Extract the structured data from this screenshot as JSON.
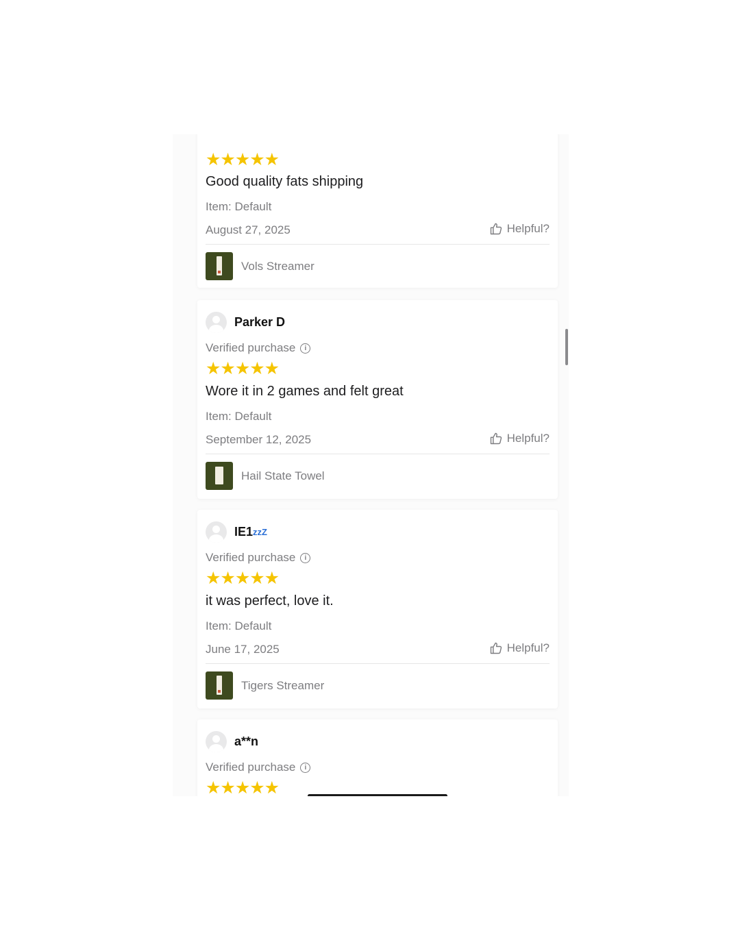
{
  "reviews": [
    {
      "stars": "★★★★★",
      "rating": 5,
      "title": "Good quality fats shipping",
      "item": "Item: Default",
      "date": "August 27, 2025",
      "helpful_label": "Helpful?",
      "product": "Vols Streamer"
    },
    {
      "reviewer": "Parker D",
      "verified": "Verified purchase",
      "stars": "★★★★★",
      "rating": 5,
      "title": "Wore it in 2 games and felt great",
      "item": "Item: Default",
      "date": "September 12, 2025",
      "helpful_label": "Helpful?",
      "product": "Hail State Towel"
    },
    {
      "reviewer": "IE1",
      "reviewer_suffix": "zzZ",
      "verified": "Verified purchase",
      "stars": "★★★★★",
      "rating": 5,
      "title": "it was perfect, love it.",
      "item": "Item: Default",
      "date": "June 17, 2025",
      "helpful_label": "Helpful?",
      "product": "Tigers Streamer"
    },
    {
      "reviewer": "a**n",
      "verified": "Verified purchase",
      "stars": "★★★★★",
      "rating": 5
    }
  ],
  "icons": {
    "thumbs_up": "thumbs-up-icon",
    "info": "info-icon",
    "avatar": "avatar-icon"
  },
  "colors": {
    "star": "#f5c400",
    "muted_text": "#7d7d80",
    "product_thumb": "#3e4a1f",
    "username_emoji": "#2b6fd6"
  }
}
